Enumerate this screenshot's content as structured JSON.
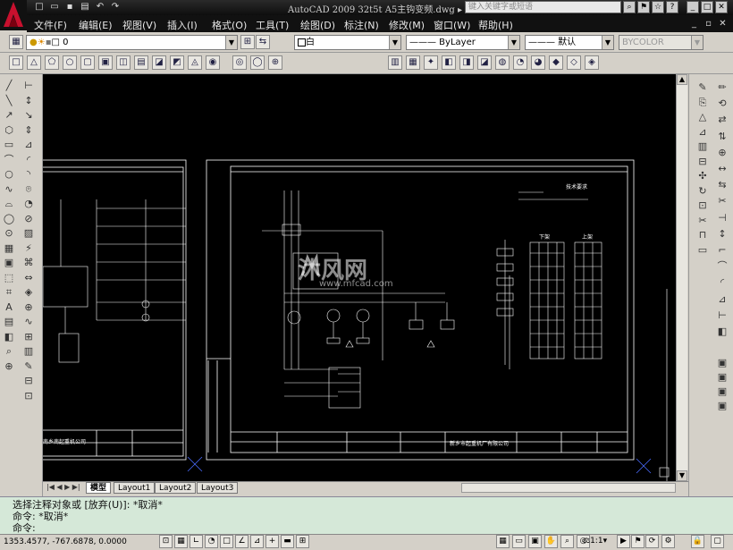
{
  "window": {
    "title": "AutoCAD 2009  32t5t  A5主钩变频.dwg  ▸",
    "help_search_placeholder": "键入关键字或短语"
  },
  "menu": [
    "文件(F)",
    "编辑(E)",
    "视图(V)",
    "插入(I)",
    "格式(O)",
    "工具(T)",
    "绘图(D)",
    "标注(N)",
    "修改(M)",
    "窗口(W)",
    "帮助(H)"
  ],
  "layer": {
    "value": "0"
  },
  "properties": {
    "color": "白",
    "linetype": "——— ByLayer",
    "lineweight": "——— 默认",
    "plotstyle": "BYCOLOR"
  },
  "tabs": [
    "模型",
    "Layout1",
    "Layout2",
    "Layout3"
  ],
  "command": {
    "line1": "选择注释对象或 [放弃(U)]: *取消*",
    "line2": "命令: *取消*",
    "line3": "命令:"
  },
  "status": {
    "coords": "1353.4577, -767.6878, 0.0000",
    "scale": "1:1"
  },
  "drawing": {
    "company_left": "南乡南起重机公司",
    "company_right": "新乡市起重机厂有限公司",
    "tech_req": "技术要求",
    "xiaji": "下架",
    "shangji": "上架"
  },
  "watermark": {
    "main": "沐风网",
    "url": "www.mfcad.com"
  },
  "colors": {
    "canvas": "#000000",
    "cmd_bg": "#d5e8d8",
    "title_bg": "#111111",
    "logo": "#c8102e"
  }
}
